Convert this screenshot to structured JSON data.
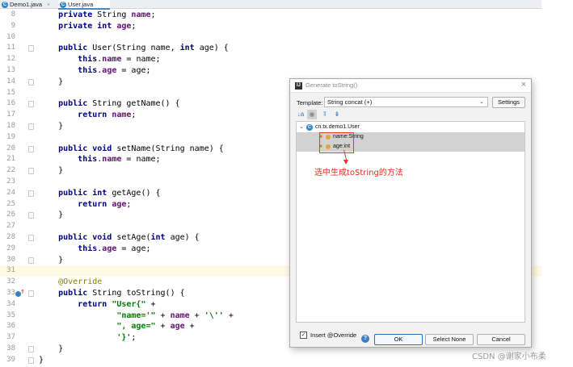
{
  "tabs": [
    {
      "label": "Demo1.java",
      "close": "×"
    },
    {
      "label": "User.java",
      "close": "×"
    }
  ],
  "tab_icon_glyph": "C",
  "editor": {
    "lines": [
      {
        "n": "8",
        "html": "    <span class=\"kw\">private</span> String <span class=\"fld\">name</span>;"
      },
      {
        "n": "9",
        "html": "    <span class=\"kw\">private int</span> <span class=\"fld\">age</span>;"
      },
      {
        "n": "10",
        "html": ""
      },
      {
        "n": "11",
        "html": "    <span class=\"kw\">public</span> User(String name, <span class=\"kw\">int</span> age) {",
        "fold": true
      },
      {
        "n": "12",
        "html": "        <span class=\"kw\">this</span>.<span class=\"fld\">name</span> = name;"
      },
      {
        "n": "13",
        "html": "        <span class=\"kw\">this</span>.<span class=\"fld\">age</span> = age;"
      },
      {
        "n": "14",
        "html": "    }",
        "fold": true
      },
      {
        "n": "15",
        "html": ""
      },
      {
        "n": "16",
        "html": "    <span class=\"kw\">public</span> String getName() {",
        "fold": true
      },
      {
        "n": "17",
        "html": "        <span class=\"kw\">return</span> <span class=\"fld\">name</span>;"
      },
      {
        "n": "18",
        "html": "    }",
        "fold": true
      },
      {
        "n": "19",
        "html": ""
      },
      {
        "n": "20",
        "html": "    <span class=\"kw\">public void</span> setName(String name) {",
        "fold": true
      },
      {
        "n": "21",
        "html": "        <span class=\"kw\">this</span>.<span class=\"fld\">name</span> = name;"
      },
      {
        "n": "22",
        "html": "    }",
        "fold": true
      },
      {
        "n": "23",
        "html": ""
      },
      {
        "n": "24",
        "html": "    <span class=\"kw\">public int</span> getAge() {",
        "fold": true
      },
      {
        "n": "25",
        "html": "        <span class=\"kw\">return</span> <span class=\"fld\">age</span>;"
      },
      {
        "n": "26",
        "html": "    }",
        "fold": true
      },
      {
        "n": "27",
        "html": ""
      },
      {
        "n": "28",
        "html": "    <span class=\"kw\">public void</span> setAge(<span class=\"kw\">int</span> age) {",
        "fold": true
      },
      {
        "n": "29",
        "html": "        <span class=\"kw\">this</span>.<span class=\"fld\">age</span> = age;"
      },
      {
        "n": "30",
        "html": "    }",
        "fold": true
      },
      {
        "n": "31",
        "html": "",
        "highlight": true
      },
      {
        "n": "32",
        "html": "    <span class=\"ann\">@Override</span>"
      },
      {
        "n": "33",
        "html": "    <span class=\"kw\">public</span> String toString() {",
        "fold": true,
        "override_marker": true
      },
      {
        "n": "34",
        "html": "        <span class=\"kw\">return</span> <span class=\"str\">\"User{\"</span> +"
      },
      {
        "n": "35",
        "html": "                <span class=\"str\">\"name='\"</span> + <span class=\"fld\">name</span> + <span class=\"str\">'\\''</span> +"
      },
      {
        "n": "36",
        "html": "                <span class=\"str\">\", age=\"</span> + <span class=\"fld\">age</span> +"
      },
      {
        "n": "37",
        "html": "                <span class=\"str\">'}'</span>;"
      },
      {
        "n": "38",
        "html": "    }",
        "fold": true
      },
      {
        "n": "39",
        "html": "}",
        "fold": true
      }
    ]
  },
  "dialog": {
    "title": "Generate toString()",
    "close_glyph": "×",
    "app_icon_glyph": "IJ",
    "template_label": "Template:",
    "template_value": "String concat (+)",
    "select_chevron": "⌄",
    "settings_label": "Settings",
    "tool_glyphs": [
      "↓a",
      "◉",
      "⫪",
      "⇟"
    ],
    "tree_toggle": "⌄",
    "class_icon_glyph": "C",
    "class_name": "cn.tx.demo1.User",
    "fields": [
      "name:String",
      "age:int"
    ],
    "field_lock_glyph": "🔒",
    "insert_override_label": "Insert @Override",
    "insert_override_checked_glyph": "✓",
    "help_glyph": "?",
    "ok_label": "OK",
    "select_none_label": "Select None",
    "cancel_label": "Cancel"
  },
  "annotation": {
    "text": "选中生成toString的方法",
    "color": "#e02b20"
  },
  "watermark": "CSDN @谢家小布柔",
  "colors": {
    "keyword": "#000080",
    "field": "#660e7a",
    "string": "#008000",
    "annotation": "#808000",
    "current_line": "#fffae3"
  }
}
